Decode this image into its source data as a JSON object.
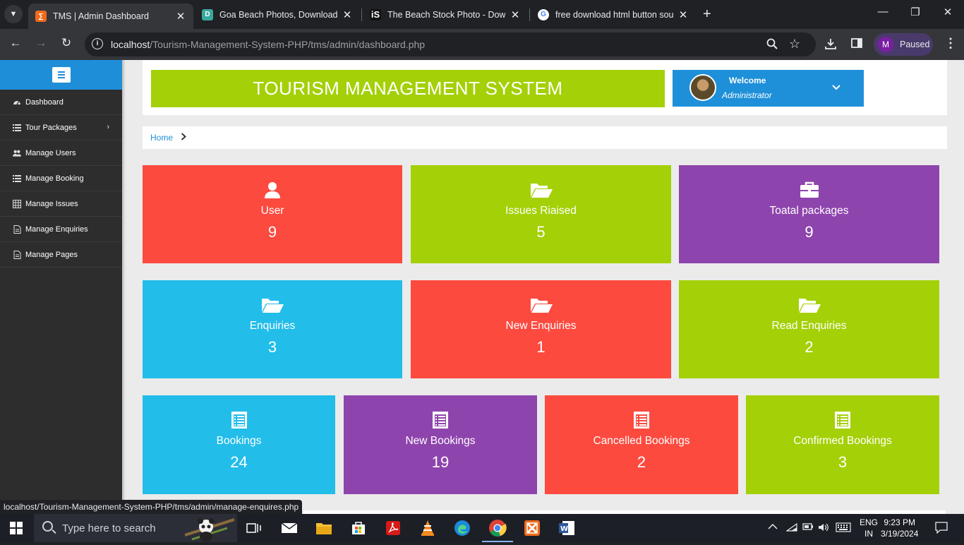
{
  "browser": {
    "tabs": [
      {
        "title": "TMS | Admin Dashboard",
        "icon": "xampp-favicon",
        "color": "#f06a1a"
      },
      {
        "title": "Goa Beach Photos, Download T",
        "icon": "photo-site-favicon",
        "color": "#3aa99f"
      },
      {
        "title": "The Beach Stock Photo - Downl",
        "icon": "istock-favicon",
        "color": "#111111"
      },
      {
        "title": "free download html button sou",
        "icon": "google-favicon",
        "color": "#ffffff"
      }
    ],
    "url_host": "localhost",
    "url_path": "/Tourism-Management-System-PHP/tms/admin/dashboard.php",
    "profile_initial": "M",
    "profile_status": "Paused",
    "status_bar_url": "localhost/Tourism-Management-System-PHP/tms/admin/manage-enquires.php"
  },
  "sidebar": {
    "items": [
      {
        "label": "Dashboard",
        "icon": "dashboard-icon"
      },
      {
        "label": "Tour Packages",
        "icon": "list-icon",
        "has_submenu": true
      },
      {
        "label": "Manage Users",
        "icon": "users-icon"
      },
      {
        "label": "Manage Booking",
        "icon": "list-icon"
      },
      {
        "label": "Manage Issues",
        "icon": "table-icon"
      },
      {
        "label": "Manage Enquiries",
        "icon": "file-icon"
      },
      {
        "label": "Manage Pages",
        "icon": "file-icon"
      }
    ]
  },
  "header": {
    "brand": "TOURISM MANAGEMENT SYSTEM",
    "welcome": "Welcome",
    "role": "Administrator"
  },
  "breadcrumb": {
    "home": "Home"
  },
  "colors": {
    "red": "#fc4a3f",
    "green": "#a4d007",
    "purple": "#8e44ad",
    "blue": "#22bde9"
  },
  "cards_row1": [
    {
      "label": "User",
      "value": "9",
      "icon": "user-icon",
      "color": "#fc4a3f"
    },
    {
      "label": "Issues Riaised",
      "value": "5",
      "icon": "folder-open-icon",
      "color": "#a4d007"
    },
    {
      "label": "Toatal packages",
      "value": "9",
      "icon": "briefcase-icon",
      "color": "#8e44ad"
    }
  ],
  "cards_row2": [
    {
      "label": "Enquiries",
      "value": "3",
      "icon": "folder-open-icon",
      "color": "#22bde9"
    },
    {
      "label": "New Enquiries",
      "value": "1",
      "icon": "folder-open-icon",
      "color": "#fc4a3f"
    },
    {
      "label": "Read Enquiries",
      "value": "2",
      "icon": "folder-open-icon",
      "color": "#a4d007"
    }
  ],
  "cards_row3": [
    {
      "label": "Bookings",
      "value": "24",
      "icon": "list-alt-icon",
      "color": "#22bde9"
    },
    {
      "label": "New Bookings",
      "value": "19",
      "icon": "list-alt-icon",
      "color": "#8e44ad"
    },
    {
      "label": "Cancelled Bookings",
      "value": "2",
      "icon": "list-alt-icon",
      "color": "#fc4a3f"
    },
    {
      "label": "Confirmed Bookings",
      "value": "3",
      "icon": "list-alt-icon",
      "color": "#a4d007"
    }
  ],
  "taskbar": {
    "search_placeholder": "Type here to search",
    "lang": "ENG",
    "region": "IN",
    "time": "9:23 PM",
    "date": "3/19/2024"
  }
}
